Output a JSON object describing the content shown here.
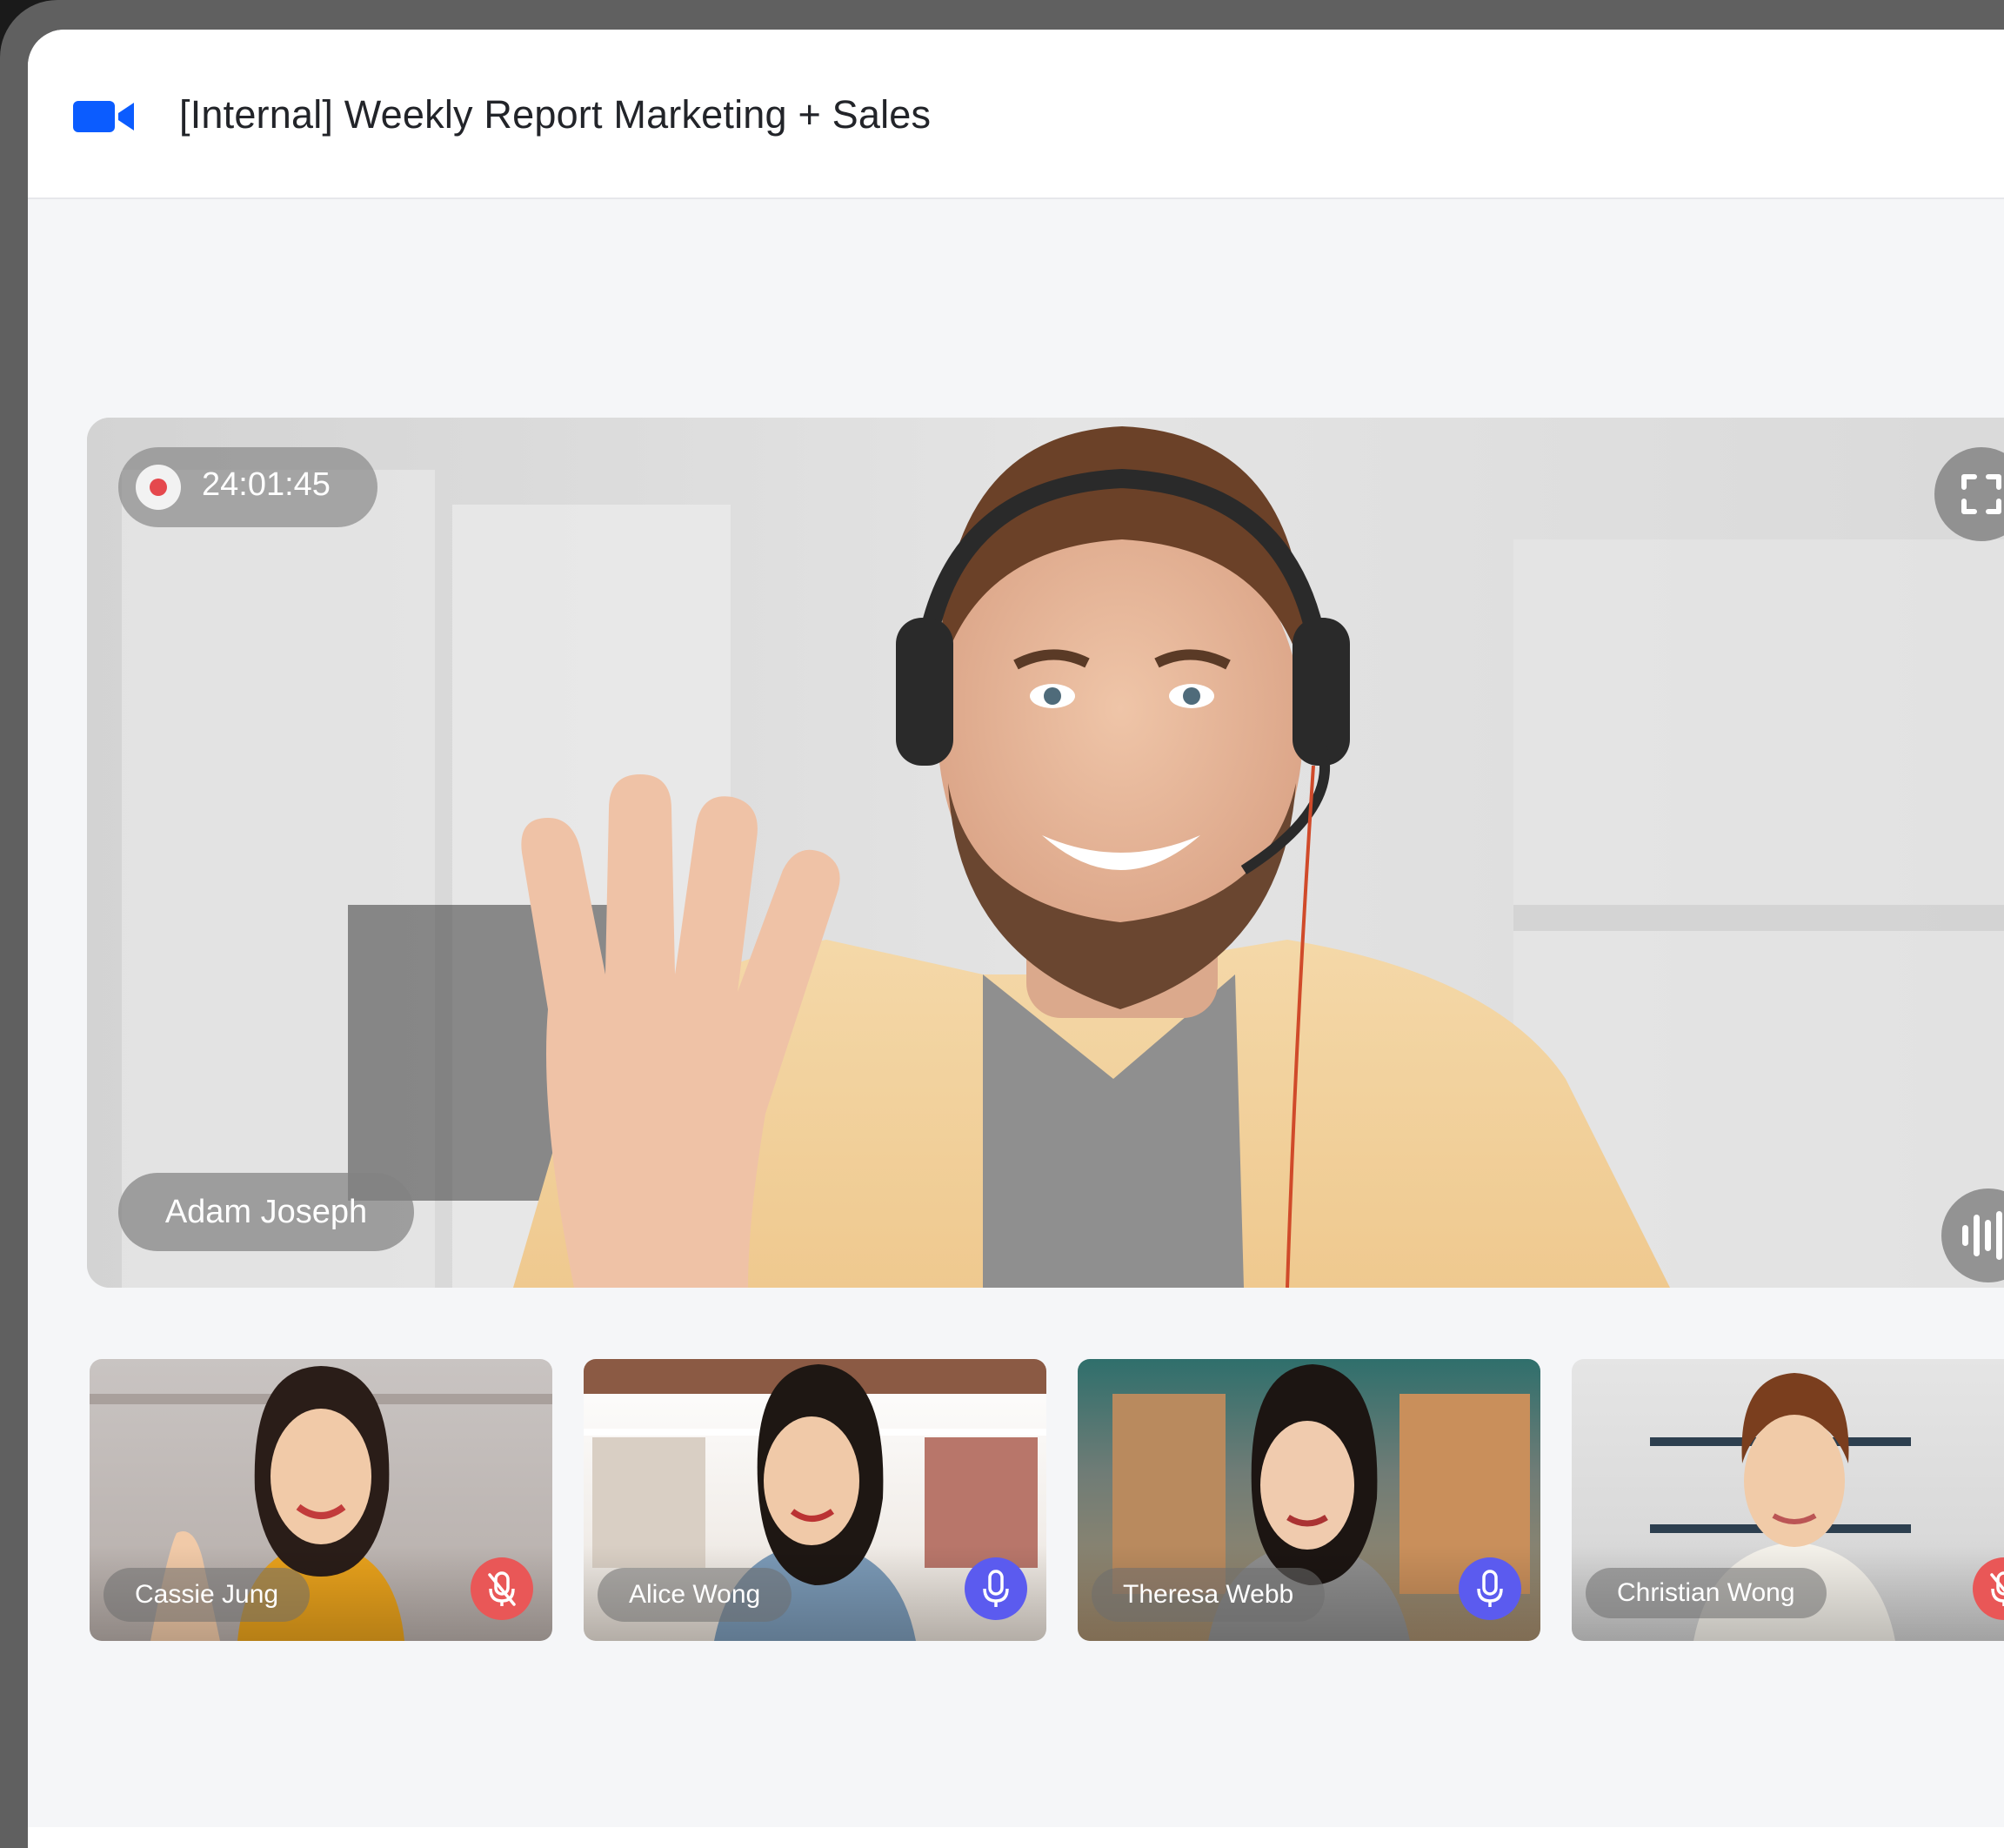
{
  "header": {
    "title": "[Internal] Weekly Report Marketing + Sales",
    "logo_icon": "video-camera-icon",
    "brand_color": "#0b5cff"
  },
  "stage": {
    "recording_time": "24:01:45",
    "speaker_name": "Adam Joseph",
    "recording_color": "#e5484d"
  },
  "participants": [
    {
      "name": "Cassie Jung",
      "mic": "muted",
      "mic_icon": "mic-off-icon"
    },
    {
      "name": "Alice Wong",
      "mic": "on",
      "mic_icon": "mic-icon"
    },
    {
      "name": "Theresa Webb",
      "mic": "on",
      "mic_icon": "mic-icon"
    },
    {
      "name": "Christian Wong",
      "mic": "muted",
      "mic_icon": "mic-off-icon"
    }
  ],
  "colors": {
    "muted": "#e95757",
    "active_mic": "#5b5bef"
  }
}
